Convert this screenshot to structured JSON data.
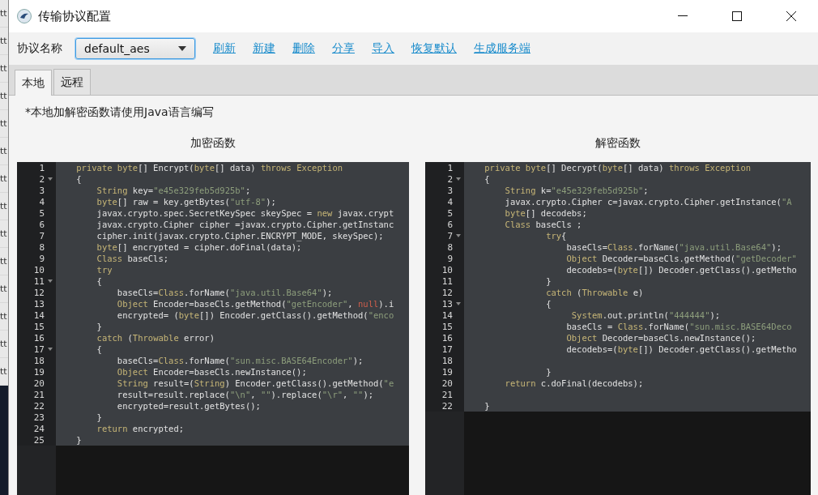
{
  "backdrop_rows": [
    "tt",
    "tt",
    "tt",
    "tt",
    "tt",
    "tt",
    "tt",
    "tt",
    "tt",
    "tt",
    "tt",
    "tt",
    "tt",
    "tt"
  ],
  "window": {
    "title": "传输协议配置"
  },
  "toolbar": {
    "label": "协议名称",
    "protocol": {
      "value": "default_aes"
    },
    "links": [
      "刷新",
      "新建",
      "删除",
      "分享",
      "导入",
      "恢复默认",
      "生成服务端"
    ]
  },
  "tabs": [
    {
      "label": "本地",
      "selected": true
    },
    {
      "label": "远程",
      "selected": false
    }
  ],
  "note": "*本地加解密函数请使用Java语言编写",
  "editors": [
    {
      "title": "加密函数",
      "lines": [
        {
          "n": "1",
          "fold": false,
          "tokens": [
            {
              "kind": "keyword",
              "t": "    private byte"
            },
            {
              "kind": "plain",
              "t": "[] Encrypt("
            },
            {
              "kind": "keyword",
              "t": "byte"
            },
            {
              "kind": "plain",
              "t": "[] data) "
            },
            {
              "kind": "keyword",
              "t": "throws Exception"
            }
          ]
        },
        {
          "n": "2",
          "fold": true,
          "tokens": [
            {
              "kind": "plain",
              "t": "    {"
            }
          ]
        },
        {
          "n": "3",
          "fold": false,
          "tokens": [
            {
              "kind": "keyword",
              "t": "        String"
            },
            {
              "kind": "plain",
              "t": " key="
            },
            {
              "kind": "string",
              "t": "\"e45e329feb5d925b\""
            },
            {
              "kind": "plain",
              "t": ";"
            }
          ]
        },
        {
          "n": "4",
          "fold": false,
          "tokens": [
            {
              "kind": "keyword",
              "t": "        byte"
            },
            {
              "kind": "plain",
              "t": "[] raw = key.getBytes("
            },
            {
              "kind": "string",
              "t": "\"utf-8\""
            },
            {
              "kind": "plain",
              "t": ");"
            }
          ]
        },
        {
          "n": "5",
          "fold": false,
          "tokens": [
            {
              "kind": "plain",
              "t": "        javax.crypto.spec.SecretKeySpec skeySpec = "
            },
            {
              "kind": "keyword",
              "t": "new"
            },
            {
              "kind": "plain",
              "t": " javax.crypt"
            }
          ]
        },
        {
          "n": "6",
          "fold": false,
          "tokens": [
            {
              "kind": "plain",
              "t": "        javax.crypto.Cipher cipher =javax.crypto.Cipher.getInstanc"
            }
          ]
        },
        {
          "n": "7",
          "fold": false,
          "tokens": [
            {
              "kind": "plain",
              "t": "        cipher.init(javax.crypto.Cipher.ENCRYPT_MODE, skeySpec);"
            }
          ]
        },
        {
          "n": "8",
          "fold": false,
          "tokens": [
            {
              "kind": "keyword",
              "t": "        byte"
            },
            {
              "kind": "plain",
              "t": "[] encrypted = cipher.doFinal(data);"
            }
          ]
        },
        {
          "n": "9",
          "fold": false,
          "tokens": [
            {
              "kind": "keyword",
              "t": "        Class"
            },
            {
              "kind": "plain",
              "t": " baseCls;"
            }
          ]
        },
        {
          "n": "10",
          "fold": false,
          "tokens": [
            {
              "kind": "keyword",
              "t": "        try"
            }
          ]
        },
        {
          "n": "11",
          "fold": true,
          "tokens": [
            {
              "kind": "plain",
              "t": "        {"
            }
          ]
        },
        {
          "n": "12",
          "fold": false,
          "tokens": [
            {
              "kind": "plain",
              "t": "            baseCls="
            },
            {
              "kind": "keyword",
              "t": "Class"
            },
            {
              "kind": "plain",
              "t": ".forName("
            },
            {
              "kind": "string",
              "t": "\"java.util.Base64\""
            },
            {
              "kind": "plain",
              "t": ");"
            }
          ]
        },
        {
          "n": "13",
          "fold": false,
          "tokens": [
            {
              "kind": "keyword",
              "t": "            Object"
            },
            {
              "kind": "plain",
              "t": " Encoder=baseCls.getMethod("
            },
            {
              "kind": "string",
              "t": "\"getEncoder\""
            },
            {
              "kind": "plain",
              "t": ", "
            },
            {
              "kind": "literal",
              "t": "null"
            },
            {
              "kind": "plain",
              "t": ").i"
            }
          ]
        },
        {
          "n": "14",
          "fold": false,
          "tokens": [
            {
              "kind": "plain",
              "t": "            encrypted= ("
            },
            {
              "kind": "keyword",
              "t": "byte"
            },
            {
              "kind": "plain",
              "t": "[]) Encoder.getClass().getMethod("
            },
            {
              "kind": "string",
              "t": "\"enco"
            }
          ]
        },
        {
          "n": "15",
          "fold": false,
          "tokens": [
            {
              "kind": "plain",
              "t": "        }"
            }
          ]
        },
        {
          "n": "16",
          "fold": false,
          "tokens": [
            {
              "kind": "keyword",
              "t": "        catch"
            },
            {
              "kind": "plain",
              "t": " ("
            },
            {
              "kind": "keyword",
              "t": "Throwable"
            },
            {
              "kind": "plain",
              "t": " error)"
            }
          ]
        },
        {
          "n": "17",
          "fold": true,
          "tokens": [
            {
              "kind": "plain",
              "t": "        {"
            }
          ]
        },
        {
          "n": "18",
          "fold": false,
          "tokens": [
            {
              "kind": "plain",
              "t": "            baseCls="
            },
            {
              "kind": "keyword",
              "t": "Class"
            },
            {
              "kind": "plain",
              "t": ".forName("
            },
            {
              "kind": "string",
              "t": "\"sun.misc.BASE64Encoder\""
            },
            {
              "kind": "plain",
              "t": ");"
            }
          ]
        },
        {
          "n": "19",
          "fold": false,
          "tokens": [
            {
              "kind": "keyword",
              "t": "            Object"
            },
            {
              "kind": "plain",
              "t": " Encoder=baseCls.newInstance();"
            }
          ]
        },
        {
          "n": "20",
          "fold": false,
          "tokens": [
            {
              "kind": "keyword",
              "t": "            String"
            },
            {
              "kind": "plain",
              "t": " result=("
            },
            {
              "kind": "keyword",
              "t": "String"
            },
            {
              "kind": "plain",
              "t": ") Encoder.getClass().getMethod("
            },
            {
              "kind": "string",
              "t": "\"e"
            }
          ]
        },
        {
          "n": "21",
          "fold": false,
          "tokens": [
            {
              "kind": "plain",
              "t": "            result=result.replace("
            },
            {
              "kind": "string",
              "t": "\"\\n\""
            },
            {
              "kind": "plain",
              "t": ", "
            },
            {
              "kind": "string",
              "t": "\"\""
            },
            {
              "kind": "plain",
              "t": ").replace("
            },
            {
              "kind": "string",
              "t": "\"\\r\""
            },
            {
              "kind": "plain",
              "t": ", "
            },
            {
              "kind": "string",
              "t": "\"\""
            },
            {
              "kind": "plain",
              "t": ");"
            }
          ]
        },
        {
          "n": "22",
          "fold": false,
          "tokens": [
            {
              "kind": "plain",
              "t": "            encrypted=result.getBytes();"
            }
          ]
        },
        {
          "n": "23",
          "fold": false,
          "tokens": [
            {
              "kind": "plain",
              "t": "        }"
            }
          ]
        },
        {
          "n": "24",
          "fold": false,
          "tokens": [
            {
              "kind": "keyword",
              "t": "        return"
            },
            {
              "kind": "plain",
              "t": " encrypted;"
            }
          ]
        },
        {
          "n": "25",
          "fold": false,
          "tokens": [
            {
              "kind": "plain",
              "t": "    }"
            }
          ]
        }
      ]
    },
    {
      "title": "解密函数",
      "lines": [
        {
          "n": "1",
          "fold": false,
          "tokens": [
            {
              "kind": "keyword",
              "t": "    private byte"
            },
            {
              "kind": "plain",
              "t": "[] Decrypt("
            },
            {
              "kind": "keyword",
              "t": "byte"
            },
            {
              "kind": "plain",
              "t": "[] data) "
            },
            {
              "kind": "keyword",
              "t": "throws Exception"
            }
          ]
        },
        {
          "n": "2",
          "fold": true,
          "tokens": [
            {
              "kind": "plain",
              "t": "    {"
            }
          ]
        },
        {
          "n": "3",
          "fold": false,
          "tokens": [
            {
              "kind": "keyword",
              "t": "        String"
            },
            {
              "kind": "plain",
              "t": " k="
            },
            {
              "kind": "string",
              "t": "\"e45e329feb5d925b\""
            },
            {
              "kind": "plain",
              "t": ";"
            }
          ]
        },
        {
          "n": "4",
          "fold": false,
          "tokens": [
            {
              "kind": "plain",
              "t": "        javax.crypto.Cipher c=javax.crypto.Cipher.getInstance("
            },
            {
              "kind": "string",
              "t": "\"A"
            }
          ]
        },
        {
          "n": "5",
          "fold": false,
          "tokens": [
            {
              "kind": "keyword",
              "t": "        byte"
            },
            {
              "kind": "plain",
              "t": "[] decodebs;"
            }
          ]
        },
        {
          "n": "6",
          "fold": false,
          "tokens": [
            {
              "kind": "keyword",
              "t": "        Class"
            },
            {
              "kind": "plain",
              "t": " baseCls ;"
            }
          ]
        },
        {
          "n": "7",
          "fold": true,
          "tokens": [
            {
              "kind": "keyword",
              "t": "                try"
            },
            {
              "kind": "plain",
              "t": "{"
            }
          ]
        },
        {
          "n": "8",
          "fold": false,
          "tokens": [
            {
              "kind": "plain",
              "t": "                    baseCls="
            },
            {
              "kind": "keyword",
              "t": "Class"
            },
            {
              "kind": "plain",
              "t": ".forName("
            },
            {
              "kind": "string",
              "t": "\"java.util.Base64\""
            },
            {
              "kind": "plain",
              "t": ");"
            }
          ]
        },
        {
          "n": "9",
          "fold": false,
          "tokens": [
            {
              "kind": "keyword",
              "t": "                    Object"
            },
            {
              "kind": "plain",
              "t": " Decoder=baseCls.getMethod("
            },
            {
              "kind": "string",
              "t": "\"getDecoder\""
            }
          ]
        },
        {
          "n": "10",
          "fold": false,
          "tokens": [
            {
              "kind": "plain",
              "t": "                    decodebs=("
            },
            {
              "kind": "keyword",
              "t": "byte"
            },
            {
              "kind": "plain",
              "t": "[]) Decoder.getClass().getMetho"
            }
          ]
        },
        {
          "n": "11",
          "fold": false,
          "tokens": [
            {
              "kind": "plain",
              "t": "                }"
            }
          ]
        },
        {
          "n": "12",
          "fold": false,
          "tokens": [
            {
              "kind": "keyword",
              "t": "                catch"
            },
            {
              "kind": "plain",
              "t": " ("
            },
            {
              "kind": "keyword",
              "t": "Throwable"
            },
            {
              "kind": "plain",
              "t": " e)"
            }
          ]
        },
        {
          "n": "13",
          "fold": true,
          "tokens": [
            {
              "kind": "plain",
              "t": "                {"
            }
          ]
        },
        {
          "n": "14",
          "fold": false,
          "tokens": [
            {
              "kind": "keyword",
              "t": "                     System"
            },
            {
              "kind": "plain",
              "t": ".out.println("
            },
            {
              "kind": "string",
              "t": "\"444444\""
            },
            {
              "kind": "plain",
              "t": ");"
            }
          ]
        },
        {
          "n": "15",
          "fold": false,
          "tokens": [
            {
              "kind": "plain",
              "t": "                    baseCls = "
            },
            {
              "kind": "keyword",
              "t": "Class"
            },
            {
              "kind": "plain",
              "t": ".forName("
            },
            {
              "kind": "string",
              "t": "\"sun.misc.BASE64Deco"
            }
          ]
        },
        {
          "n": "16",
          "fold": false,
          "tokens": [
            {
              "kind": "keyword",
              "t": "                    Object"
            },
            {
              "kind": "plain",
              "t": " Decoder=baseCls.newInstance();"
            }
          ]
        },
        {
          "n": "17",
          "fold": false,
          "tokens": [
            {
              "kind": "plain",
              "t": "                    decodebs=("
            },
            {
              "kind": "keyword",
              "t": "byte"
            },
            {
              "kind": "plain",
              "t": "[]) Decoder.getClass().getMetho"
            }
          ]
        },
        {
          "n": "18",
          "fold": false
        },
        {
          "n": "19",
          "fold": false,
          "tokens": [
            {
              "kind": "plain",
              "t": "                }"
            }
          ]
        },
        {
          "n": "20",
          "fold": false,
          "tokens": [
            {
              "kind": "keyword",
              "t": "        return"
            },
            {
              "kind": "plain",
              "t": " c.doFinal(decodebs);"
            }
          ]
        },
        {
          "n": "21",
          "fold": false
        },
        {
          "n": "22",
          "fold": false,
          "tokens": [
            {
              "kind": "plain",
              "t": "    }"
            }
          ]
        }
      ]
    }
  ]
}
